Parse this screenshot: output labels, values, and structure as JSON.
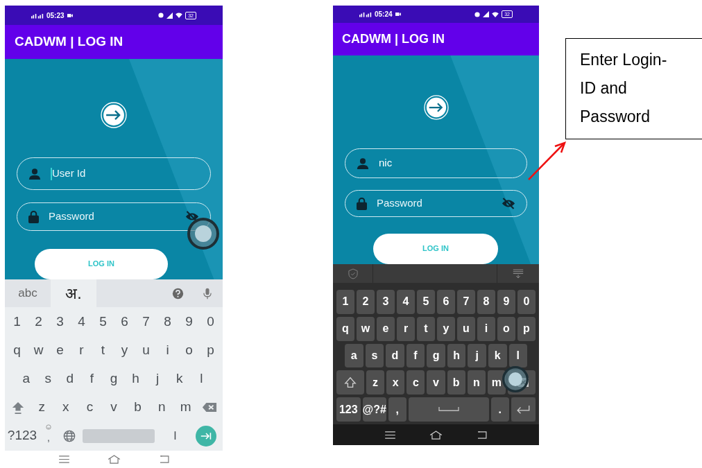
{
  "phones": [
    {
      "dark": false,
      "status_bar": {
        "time": "05:23",
        "battery": "32"
      },
      "app_bar": {
        "title": "CADWM | LOG IN"
      },
      "fields": [
        {
          "kind": "user",
          "placeholder": "User Id",
          "focused": true,
          "touched": false
        },
        {
          "kind": "password",
          "placeholder": "Password",
          "focused": false,
          "touched": true
        }
      ],
      "login_button": "LOG IN",
      "keyboard": {
        "tabs": [
          {
            "label": "abc",
            "selected": false
          },
          {
            "label": "अ.",
            "selected": true
          }
        ],
        "rows": [
          [
            {
              "kind": "char",
              "label": "1"
            },
            {
              "kind": "char",
              "label": "2"
            },
            {
              "kind": "char",
              "label": "3"
            },
            {
              "kind": "char",
              "label": "4"
            },
            {
              "kind": "char",
              "label": "5"
            },
            {
              "kind": "char",
              "label": "6"
            },
            {
              "kind": "char",
              "label": "7"
            },
            {
              "kind": "char",
              "label": "8"
            },
            {
              "kind": "char",
              "label": "9"
            },
            {
              "kind": "char",
              "label": "0"
            }
          ],
          [
            {
              "kind": "char",
              "label": "q"
            },
            {
              "kind": "char",
              "label": "w"
            },
            {
              "kind": "char",
              "label": "e"
            },
            {
              "kind": "char",
              "label": "r"
            },
            {
              "kind": "char",
              "label": "t"
            },
            {
              "kind": "char",
              "label": "y"
            },
            {
              "kind": "char",
              "label": "u"
            },
            {
              "kind": "char",
              "label": "i"
            },
            {
              "kind": "char",
              "label": "o"
            },
            {
              "kind": "char",
              "label": "p"
            }
          ],
          [
            {
              "kind": "char",
              "label": "a"
            },
            {
              "kind": "char",
              "label": "s"
            },
            {
              "kind": "char",
              "label": "d"
            },
            {
              "kind": "char",
              "label": "f"
            },
            {
              "kind": "char",
              "label": "g"
            },
            {
              "kind": "char",
              "label": "h"
            },
            {
              "kind": "char",
              "label": "j"
            },
            {
              "kind": "char",
              "label": "k"
            },
            {
              "kind": "char",
              "label": "l"
            }
          ],
          [
            {
              "kind": "shift"
            },
            {
              "kind": "char",
              "label": "z"
            },
            {
              "kind": "char",
              "label": "x"
            },
            {
              "kind": "char",
              "label": "c"
            },
            {
              "kind": "char",
              "label": "v"
            },
            {
              "kind": "char",
              "label": "b"
            },
            {
              "kind": "char",
              "label": "n"
            },
            {
              "kind": "char",
              "label": "m"
            },
            {
              "kind": "backspace",
              "touched": false
            }
          ],
          [
            {
              "kind": "mode",
              "label": "?123"
            },
            {
              "kind": "emoji",
              "label": ","
            },
            {
              "kind": "globe"
            },
            {
              "kind": "space"
            },
            {
              "kind": "char",
              "label": "।"
            },
            {
              "kind": "enter"
            }
          ]
        ]
      }
    },
    {
      "dark": true,
      "status_bar": {
        "time": "05:24",
        "battery": "32"
      },
      "app_bar": {
        "title": "CADWM | LOG IN"
      },
      "fields": [
        {
          "kind": "user",
          "value": "nic",
          "focused": false,
          "touched": false
        },
        {
          "kind": "password",
          "placeholder": "Password",
          "focused": false,
          "touched": false
        }
      ],
      "login_button": "LOG IN",
      "keyboard": {
        "rows": [
          [
            {
              "kind": "char",
              "label": "1"
            },
            {
              "kind": "char",
              "label": "2"
            },
            {
              "kind": "char",
              "label": "3"
            },
            {
              "kind": "char",
              "label": "4"
            },
            {
              "kind": "char",
              "label": "5"
            },
            {
              "kind": "char",
              "label": "6"
            },
            {
              "kind": "char",
              "label": "7"
            },
            {
              "kind": "char",
              "label": "8"
            },
            {
              "kind": "char",
              "label": "9"
            },
            {
              "kind": "char",
              "label": "0"
            }
          ],
          [
            {
              "kind": "char",
              "label": "q"
            },
            {
              "kind": "char",
              "label": "w"
            },
            {
              "kind": "char",
              "label": "e"
            },
            {
              "kind": "char",
              "label": "r"
            },
            {
              "kind": "char",
              "label": "t"
            },
            {
              "kind": "char",
              "label": "y"
            },
            {
              "kind": "char",
              "label": "u"
            },
            {
              "kind": "char",
              "label": "i"
            },
            {
              "kind": "char",
              "label": "o"
            },
            {
              "kind": "char",
              "label": "p"
            }
          ],
          [
            {
              "kind": "char",
              "label": "a"
            },
            {
              "kind": "char",
              "label": "s"
            },
            {
              "kind": "char",
              "label": "d"
            },
            {
              "kind": "char",
              "label": "f"
            },
            {
              "kind": "char",
              "label": "g"
            },
            {
              "kind": "char",
              "label": "h"
            },
            {
              "kind": "char",
              "label": "j"
            },
            {
              "kind": "char",
              "label": "k"
            },
            {
              "kind": "char",
              "label": "l"
            }
          ],
          [
            {
              "kind": "shift"
            },
            {
              "kind": "char",
              "label": "z"
            },
            {
              "kind": "char",
              "label": "x"
            },
            {
              "kind": "char",
              "label": "c"
            },
            {
              "kind": "char",
              "label": "v"
            },
            {
              "kind": "char",
              "label": "b"
            },
            {
              "kind": "char",
              "label": "n"
            },
            {
              "kind": "char",
              "label": "m"
            },
            {
              "kind": "backspace",
              "touched": true
            }
          ],
          [
            {
              "kind": "mode",
              "label": "123"
            },
            {
              "kind": "mode",
              "label": "@?#"
            },
            {
              "kind": "char",
              "label": ","
            },
            {
              "kind": "space"
            },
            {
              "kind": "char",
              "label": "."
            },
            {
              "kind": "enter"
            }
          ]
        ]
      }
    }
  ],
  "callout": {
    "text": "Enter Login-ID and Password"
  }
}
